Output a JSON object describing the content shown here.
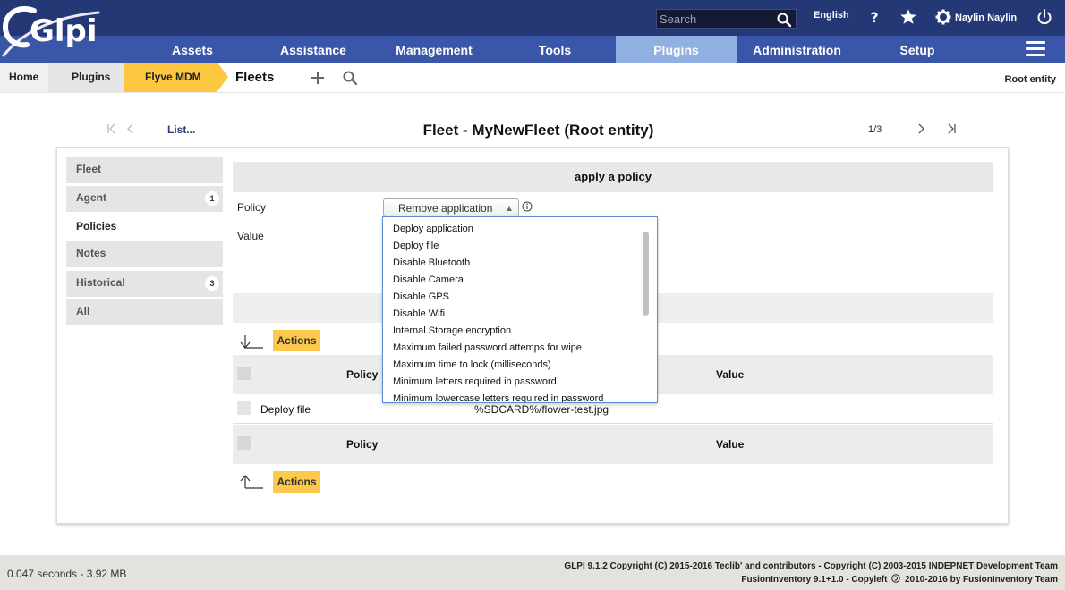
{
  "app": {
    "logo_text": "Glpi"
  },
  "topbar": {
    "search_placeholder": "Search",
    "language": "English",
    "help_icon": "question-icon",
    "bookmark_icon": "star-icon",
    "user_icon": "gear-icon",
    "user_name": "Naylin Naylin",
    "logout_icon": "power-icon"
  },
  "menu": {
    "items": [
      {
        "label": "Assets"
      },
      {
        "label": "Assistance"
      },
      {
        "label": "Management"
      },
      {
        "label": "Tools"
      },
      {
        "label": "Plugins"
      },
      {
        "label": "Administration"
      },
      {
        "label": "Setup"
      }
    ],
    "active": "Plugins",
    "active_color": "#8fb0e0",
    "bar_color": "#3a56a8",
    "top_color": "#253876"
  },
  "breadcrumb": {
    "items": [
      "Home",
      "Plugins",
      "Flyve MDM"
    ],
    "current": "Fleets",
    "accent": "#fdc840",
    "entity": "Root entity"
  },
  "navigation": {
    "list_label": "List...",
    "title": "Fleet - MyNewFleet (Root entity)",
    "pager": "1/3"
  },
  "tabs": [
    {
      "label": "Fleet",
      "badge": ""
    },
    {
      "label": "Agent",
      "badge": "1"
    },
    {
      "label": "Policies",
      "badge": ""
    },
    {
      "label": "Notes",
      "badge": ""
    },
    {
      "label": "Historical",
      "badge": "3"
    },
    {
      "label": "All",
      "badge": ""
    }
  ],
  "active_tab": "Policies",
  "form": {
    "header": "apply a policy",
    "policy_label": "Policy",
    "value_label": "Value",
    "policy_selected": "Remove application"
  },
  "dropdown": {
    "options": [
      "Deploy application",
      "Deploy file",
      "Disable Bluetooth",
      "Disable Camera",
      "Disable GPS",
      "Disable Wifi",
      "Internal Storage encryption",
      "Maximum failed password attemps for wipe",
      "Maximum time to lock (milliseconds)",
      "Minimum letters required in password",
      "Minimum lowercase letters required in password"
    ]
  },
  "table": {
    "actions_label": "Actions",
    "columns": [
      "Policy",
      "Value"
    ],
    "rows": [
      {
        "policy": "Deploy file",
        "value": "%SDCARD%/flower-test.jpg"
      }
    ],
    "action_color": "#fdc94d"
  },
  "footer": {
    "timing": "0.047 seconds - 3.92 MB",
    "copyright_line1": "GLPI 9.1.2 Copyright (C) 2015-2016 Teclib' and contributors - Copyright (C) 2003-2015 INDEPNET Development Team",
    "copyright_line2_before": "FusionInventory 9.1+1.0 - Copyleft",
    "copyright_line2_after": "2010-2016 by FusionInventory Team"
  }
}
